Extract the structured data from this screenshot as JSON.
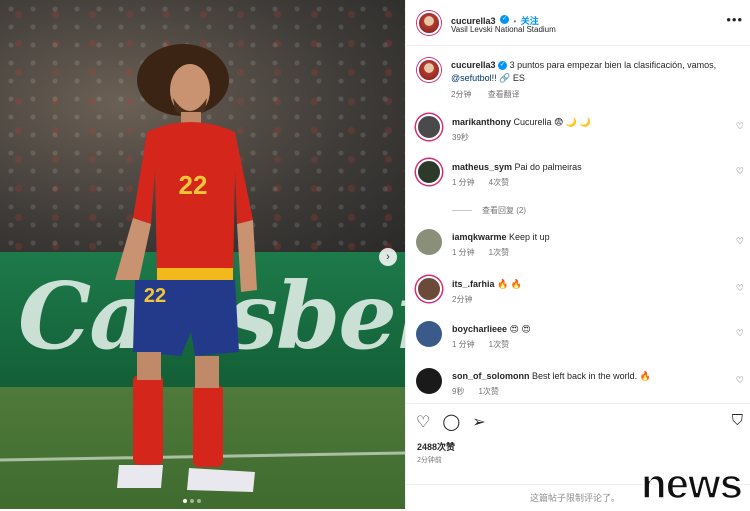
{
  "post": {
    "username": "cucurella3",
    "follow_label": "关注",
    "location": "Vasil Levski National Stadium",
    "caption_text": "3 puntos para empezar bien la clasificación, vamos,",
    "caption_mention": "@sefutbol",
    "caption_tail": "!! 🔗 ES",
    "caption_time": "2分钟",
    "translate_label": "查看翻译",
    "likes": "2488次赞",
    "posted_time": "2分钟前",
    "comments_disabled": "这篇帖子限制评论了。"
  },
  "photo": {
    "jersey_number": "22",
    "banner_text": "Carlsberg",
    "next_arrow": "›"
  },
  "comments": [
    {
      "username": "marikanthony",
      "text": "Cucurella 😨 🌙 🌙",
      "time": "39秒",
      "likes": "",
      "avatar_color": "#4a4a4a"
    },
    {
      "username": "matheus_sym",
      "text": "Pai do palmeiras",
      "time": "1 分钟",
      "likes": "4次赞",
      "avatar_color": "#2d3a2a"
    },
    {
      "username": "iamqkwarme",
      "text": "Keep it up",
      "time": "1 分钟",
      "likes": "1次赞",
      "avatar_color": "#8a8f7a"
    },
    {
      "username": "its_.farhia",
      "text": "🔥 🔥",
      "time": "2分钟",
      "likes": "",
      "avatar_color": "#6b4a3a"
    },
    {
      "username": "boycharlieee",
      "text": "😍 😍",
      "time": "1 分钟",
      "likes": "1次赞",
      "avatar_color": "#3a5a8a"
    },
    {
      "username": "son_of_solomonn",
      "text": "Best left back in the world. 🔥",
      "time": "9秒",
      "likes": "1次赞",
      "avatar_color": "#1a1a1a"
    }
  ],
  "view_replies": "查看回复 (2)",
  "watermark": "news",
  "colors": {
    "accent": "#0095f6",
    "ring": "#d62976",
    "jersey_red": "#d5261c",
    "shorts_blue": "#233a8a",
    "pitch": "#4f7a3b",
    "banner": "#1d7a4a"
  }
}
